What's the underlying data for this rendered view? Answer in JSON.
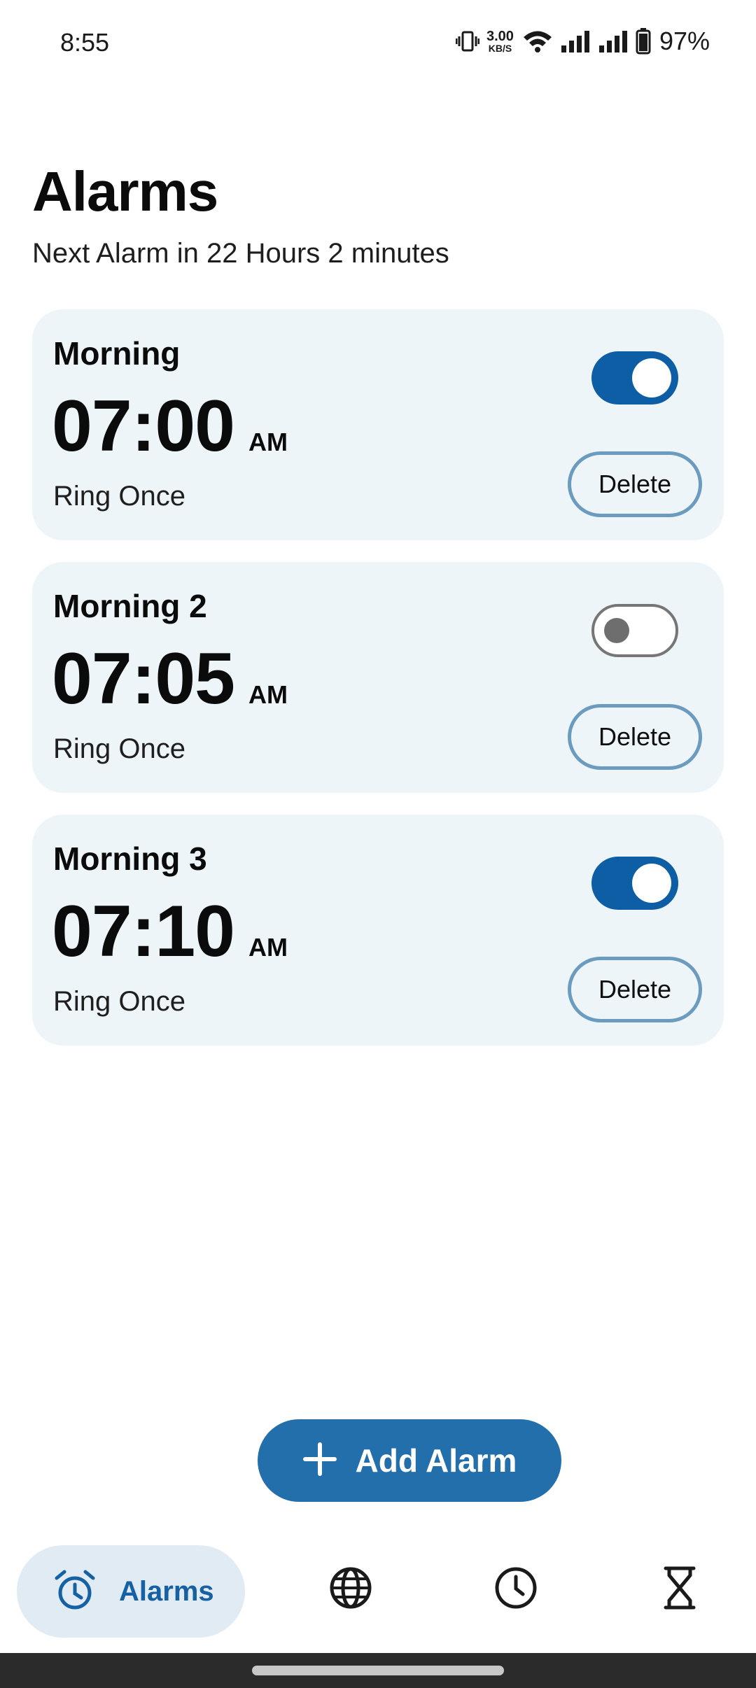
{
  "status_bar": {
    "time": "8:55",
    "net_speed_value": "3.00",
    "net_speed_unit": "KB/S",
    "battery": "97%"
  },
  "header": {
    "title": "Alarms",
    "subtitle": "Next Alarm in 22 Hours 2 minutes"
  },
  "alarms": [
    {
      "name": "Morning",
      "time": "07:00",
      "ampm": "AM",
      "repeat": "Ring Once",
      "enabled": true,
      "delete_label": "Delete"
    },
    {
      "name": "Morning 2",
      "time": "07:05",
      "ampm": "AM",
      "repeat": "Ring Once",
      "enabled": false,
      "delete_label": "Delete"
    },
    {
      "name": "Morning 3",
      "time": "07:10",
      "ampm": "AM",
      "repeat": "Ring Once",
      "enabled": true,
      "delete_label": "Delete"
    }
  ],
  "fab": {
    "label": "Add Alarm",
    "icon": "plus-icon"
  },
  "bottom_nav": {
    "items": [
      {
        "label": "Alarms",
        "icon": "alarm-clock-icon",
        "selected": true
      },
      {
        "icon": "globe-icon",
        "selected": false
      },
      {
        "icon": "clock-icon",
        "selected": false
      },
      {
        "icon": "hourglass-icon",
        "selected": false
      }
    ]
  },
  "colors": {
    "accent": "#0e5ea5",
    "fab": "#236fab",
    "card_background": "#eef5f8",
    "nav_selected_background": "#e1ebf3",
    "nav_selected_text": "#1661a3",
    "delete_border": "#6b9bbf"
  }
}
